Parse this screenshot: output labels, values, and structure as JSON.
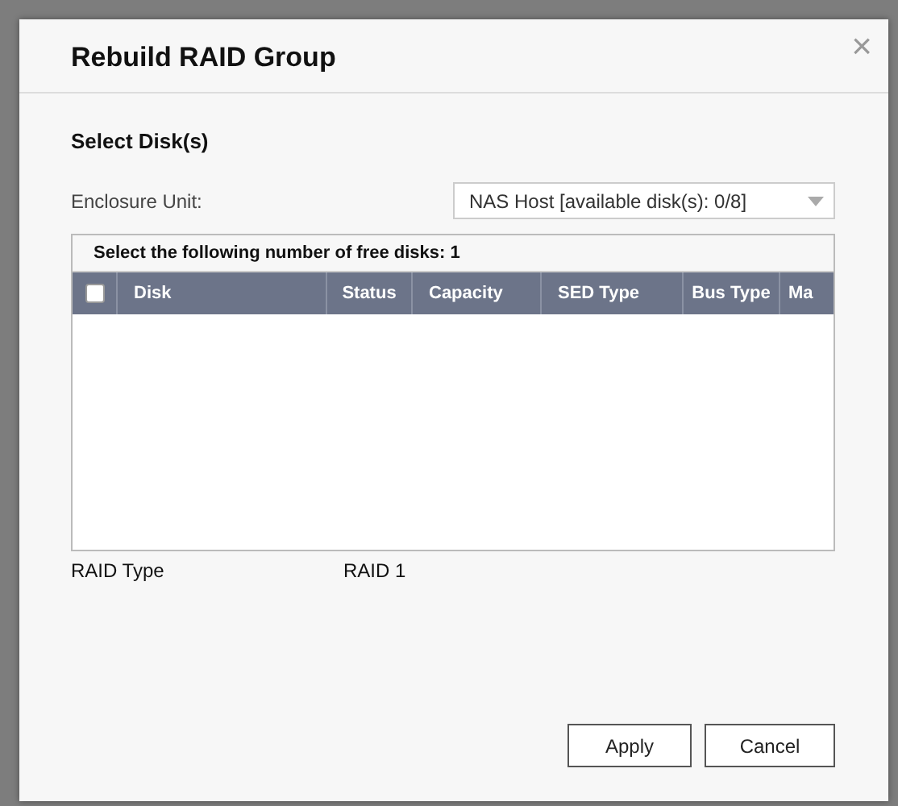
{
  "dialog": {
    "title": "Rebuild RAID Group",
    "close_label": "×"
  },
  "section_title": "Select Disk(s)",
  "enclosure": {
    "label": "Enclosure Unit:",
    "value": "NAS Host [available disk(s): 0/8]"
  },
  "disk_table": {
    "caption": "Select the following number of free disks: 1",
    "select_all_checked": false,
    "columns": [
      "Disk",
      "Status",
      "Capacity",
      "SED Type",
      "Bus Type",
      "Ma"
    ]
  },
  "raid_type": {
    "label": "RAID Type",
    "value": "RAID 1"
  },
  "buttons": [
    "Apply",
    "Cancel"
  ]
}
